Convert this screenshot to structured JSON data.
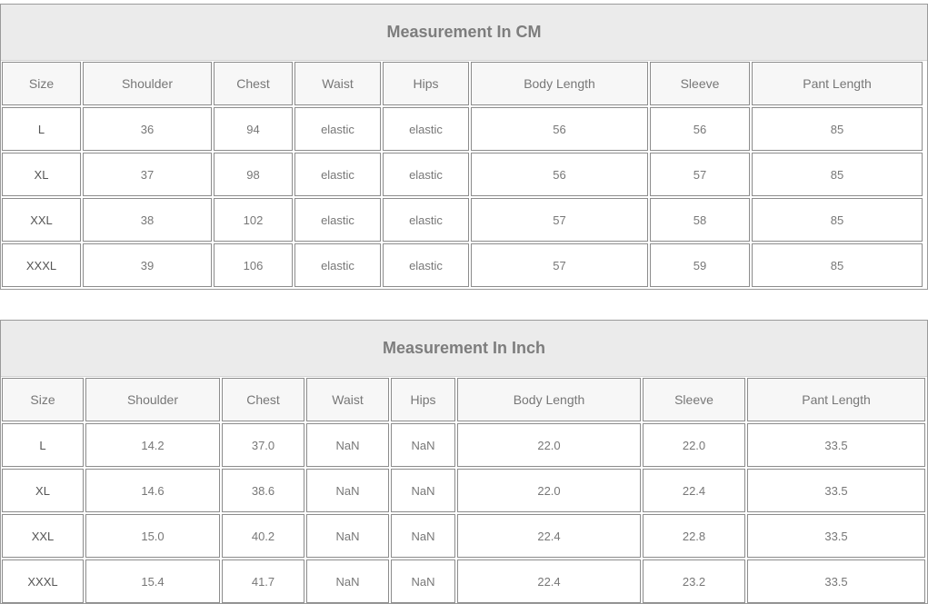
{
  "tables": [
    {
      "title": "Measurement In CM",
      "headers": [
        "Size",
        "Shoulder",
        "Chest",
        "Waist",
        "Hips",
        "Body Length",
        "Sleeve",
        "Pant Length"
      ],
      "rows": [
        [
          "L",
          "36",
          "94",
          "elastic",
          "elastic",
          "56",
          "56",
          "85"
        ],
        [
          "XL",
          "37",
          "98",
          "elastic",
          "elastic",
          "56",
          "57",
          "85"
        ],
        [
          "XXL",
          "38",
          "102",
          "elastic",
          "elastic",
          "57",
          "58",
          "85"
        ],
        [
          "XXXL",
          "39",
          "106",
          "elastic",
          "elastic",
          "57",
          "59",
          "85"
        ]
      ]
    },
    {
      "title": "Measurement In Inch",
      "headers": [
        "Size",
        "Shoulder",
        "Chest",
        "Waist",
        "Hips",
        "Body Length",
        "Sleeve",
        "Pant Length"
      ],
      "rows": [
        [
          "L",
          "14.2",
          "37.0",
          "NaN",
          "NaN",
          "22.0",
          "22.0",
          "33.5"
        ],
        [
          "XL",
          "14.6",
          "38.6",
          "NaN",
          "NaN",
          "22.0",
          "22.4",
          "33.5"
        ],
        [
          "XXL",
          "15.0",
          "40.2",
          "NaN",
          "NaN",
          "22.4",
          "22.8",
          "33.5"
        ],
        [
          "XXXL",
          "15.4",
          "41.7",
          "NaN",
          "NaN",
          "22.4",
          "23.2",
          "33.5"
        ]
      ]
    }
  ]
}
